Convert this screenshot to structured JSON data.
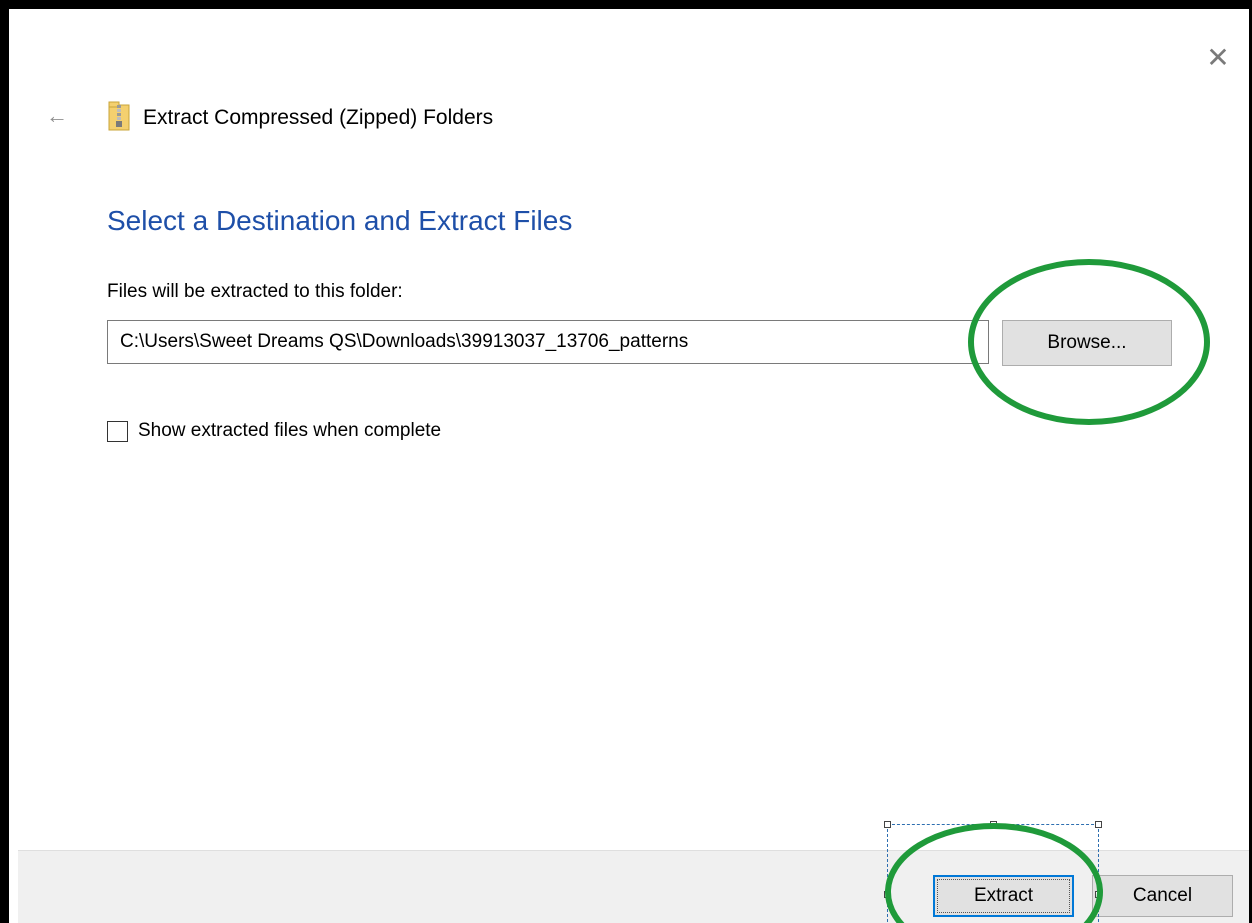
{
  "dialog": {
    "title": "Extract Compressed (Zipped) Folders",
    "close_glyph": "✕",
    "back_glyph": "←",
    "heading": "Select a Destination and Extract Files",
    "destination_label": "Files will be extracted to this folder:",
    "destination_path": "C:\\Users\\Sweet Dreams QS\\Downloads\\39913037_13706_patterns",
    "browse_label": "Browse...",
    "show_files_label": "Show extracted files when complete",
    "show_files_checked": false,
    "extract_label": "Extract",
    "cancel_label": "Cancel"
  },
  "icons": {
    "back": "arrow-left-icon",
    "close": "close-icon",
    "folder": "zip-folder-icon"
  },
  "colors": {
    "heading": "#1e4fa8",
    "focus_border": "#0078d7",
    "button_face": "#e1e1e1",
    "annotation_circle": "#1f9a3a",
    "footer": "#f0f0f0"
  }
}
